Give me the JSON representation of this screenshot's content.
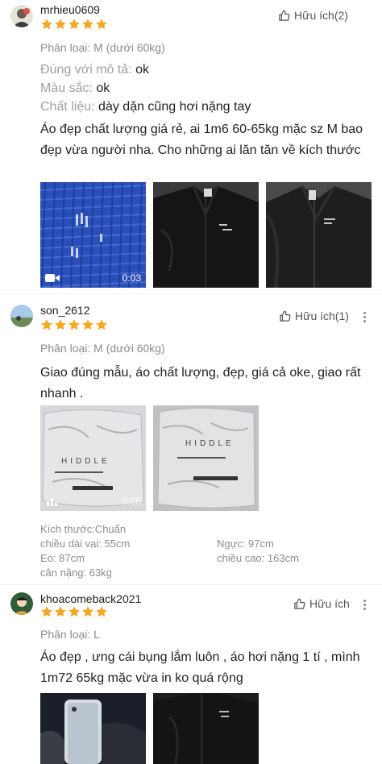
{
  "reviews": [
    {
      "username": "mrhieu0609",
      "rating": 5,
      "helpful_label": "Hữu ích(2)",
      "variant": "Phân loại: M (dưới 60kg)",
      "attributes": [
        {
          "key": "Đúng với mô tả:",
          "value": "ok"
        },
        {
          "key": "Màu sắc:",
          "value": "ok"
        },
        {
          "key": "Chất liệu:",
          "value": "dày dặn cũng hơi nặng tay"
        }
      ],
      "text": "Áo đẹp chất lượng giá rẻ, ai 1m6 60-65kg mặc sz M bao đẹp vừa người nha. Cho những ai lăn tăn về kích thước",
      "media": [
        {
          "type": "video",
          "duration": "0:03",
          "subject": "blue fabric close-up"
        },
        {
          "type": "image",
          "subject": "black jacket"
        },
        {
          "type": "image",
          "subject": "black jacket"
        }
      ]
    },
    {
      "username": "son_2612",
      "rating": 5,
      "helpful_label": "Hữu ích(1)",
      "variant": "Phân loại: M (dưới 60kg)",
      "text": "Giao đúng mẫu, áo chất lượng, đẹp, giá cả oke, giao rất nhanh .",
      "media": [
        {
          "type": "video",
          "duration": "0:00",
          "subject": "package",
          "brand": "HIDDLE"
        },
        {
          "type": "image",
          "subject": "package",
          "brand": "HIDDLE"
        }
      ],
      "specs": {
        "size": "Kích thước:Chuẩn",
        "shoulder": "chiều dài vai: 55cm",
        "chest": "Ngực: 97cm",
        "waist": "Eo: 87cm",
        "height": "chiều cao: 163cm",
        "weight": "cân nặng: 63kg"
      }
    },
    {
      "username": "khoacomeback2021",
      "rating": 5,
      "helpful_label": "Hữu ích",
      "variant": "Phân loại: L",
      "text": "Áo đẹp , ưng cái bụng lắm luôn , áo hơi nặng 1 tí , mình 1m72 65kg mặc vừa in ko quá rộng",
      "media": [
        {
          "type": "image",
          "subject": "phone selfie"
        },
        {
          "type": "image",
          "subject": "black jacket"
        }
      ]
    }
  ],
  "colors": {
    "star": "#f5a623",
    "muted": "#8c8c8c",
    "text": "#222222"
  }
}
